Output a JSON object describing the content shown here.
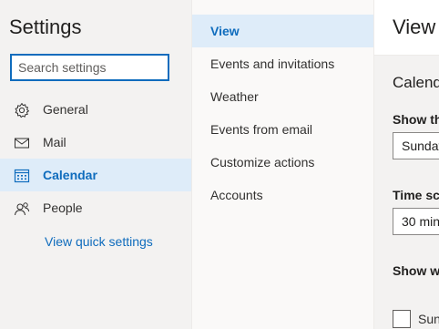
{
  "left_pane": {
    "title": "Settings",
    "search": {
      "placeholder": "Search settings",
      "value": ""
    },
    "items": [
      {
        "label": "General",
        "icon": "gear-icon"
      },
      {
        "label": "Mail",
        "icon": "mail-icon"
      },
      {
        "label": "Calendar",
        "icon": "calendar-icon",
        "active": true
      },
      {
        "label": "People",
        "icon": "people-icon"
      }
    ],
    "quick_settings_link": "View quick settings"
  },
  "middle_pane": {
    "items": [
      {
        "label": "View",
        "active": true
      },
      {
        "label": "Events and invitations"
      },
      {
        "label": "Weather"
      },
      {
        "label": "Events from email"
      },
      {
        "label": "Customize actions"
      },
      {
        "label": "Accounts"
      }
    ]
  },
  "right_pane": {
    "title": "View",
    "section_title": "Calend",
    "show_first_day_label": "Show th",
    "first_day_value": "Sunday",
    "time_scale_label": "Time sca",
    "time_scale_value": "30 min",
    "show_work_label": "Show wo",
    "day_checkbox_label": "Sun",
    "day_checkbox_checked": false
  },
  "colors": {
    "accent": "#0f6cbd",
    "active_bg": "#deecf9",
    "pane_bg": "#f3f2f1"
  }
}
